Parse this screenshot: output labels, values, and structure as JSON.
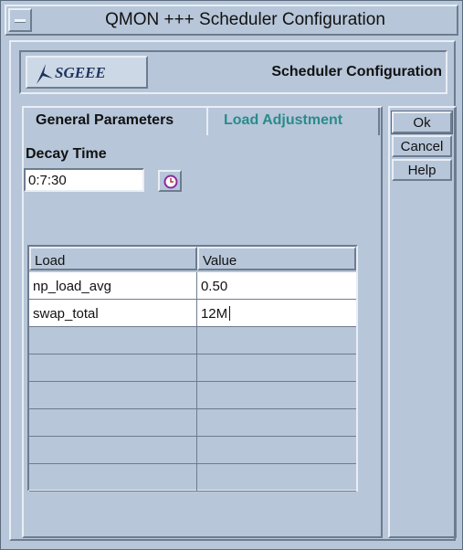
{
  "window": {
    "title": "QMON +++ Scheduler Configuration"
  },
  "header": {
    "logo_text": "SGEEE",
    "title": "Scheduler Configuration"
  },
  "tabs": [
    {
      "label": "General Parameters",
      "active": false
    },
    {
      "label": "Load Adjustment",
      "active": true
    }
  ],
  "decay": {
    "label": "Decay Time",
    "value": "0:7:30"
  },
  "table": {
    "headers": [
      "Load",
      "Value"
    ],
    "rows": [
      {
        "load": "np_load_avg",
        "value": "0.50"
      },
      {
        "load": "swap_total",
        "value": "12M"
      },
      {
        "load": "",
        "value": ""
      },
      {
        "load": "",
        "value": ""
      },
      {
        "load": "",
        "value": ""
      },
      {
        "load": "",
        "value": ""
      },
      {
        "load": "",
        "value": ""
      },
      {
        "load": "",
        "value": ""
      }
    ]
  },
  "buttons": {
    "ok": "Ok",
    "cancel": "Cancel",
    "help": "Help"
  },
  "colors": {
    "background": "#b7c6d9",
    "active_tab": "#2a8b8b",
    "logo": "#1f3560"
  },
  "icons": {
    "window_menu": "window-menu-icon",
    "logo": "sgeee-logo-icon",
    "clock": "clock-icon"
  }
}
